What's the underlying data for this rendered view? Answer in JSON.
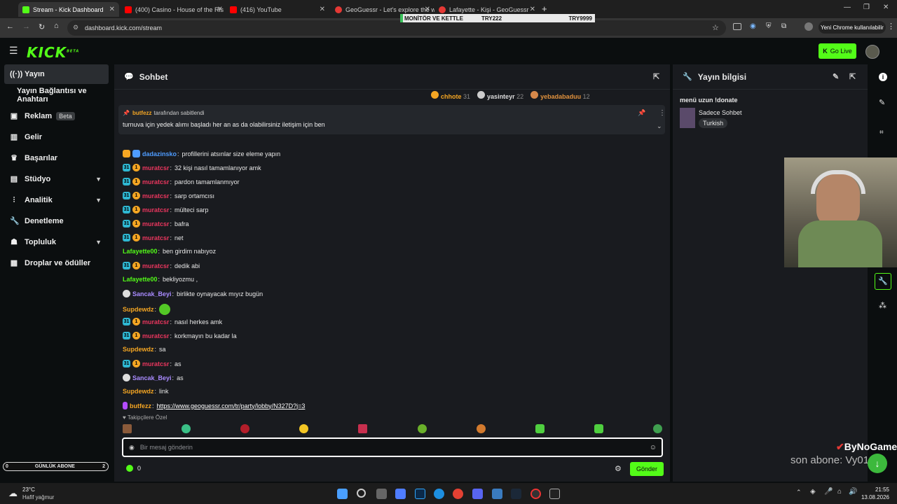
{
  "browser": {
    "tabs": [
      {
        "title": "Stream - Kick Dashboard",
        "color": "#53fc18"
      },
      {
        "title": "(400) Casino - House of the Ris",
        "color": "#ff0000"
      },
      {
        "title": "(416) YouTube",
        "color": "#ff0000"
      },
      {
        "title": "GeoGuessr - Let's explore the w",
        "color": "#e53935"
      },
      {
        "title": "Lafayette - Kişi - GeoGuessr",
        "color": "#e53935"
      }
    ],
    "url": "dashboard.kick.com/stream",
    "overlay": {
      "left": "MONİTÖR VE KETTLE",
      "mid": "TRY222",
      "right": "TRY9999"
    },
    "profile_label": "Yeni Chrome kullanılabilir"
  },
  "app": {
    "logo": "KICK",
    "logo_sup": "BETA",
    "go_live": "Go Live"
  },
  "sidebar": {
    "items": [
      {
        "label": "Yayın",
        "icon": "broadcast-icon"
      },
      {
        "label": "Yayın Bağlantısı ve Anahtarı",
        "icon": ""
      },
      {
        "label": "Reklam",
        "icon": "ad-icon",
        "badge": "Beta"
      },
      {
        "label": "Gelir",
        "icon": "revenue-icon"
      },
      {
        "label": "Başarılar",
        "icon": "trophy-icon"
      },
      {
        "label": "Stüdyo",
        "icon": "studio-icon"
      },
      {
        "label": "Analitik",
        "icon": "analytics-icon"
      },
      {
        "label": "Denetleme",
        "icon": "moderation-icon"
      },
      {
        "label": "Topluluk",
        "icon": "community-icon"
      },
      {
        "label": "Droplar ve ödüller",
        "icon": "drops-icon"
      }
    ]
  },
  "chat": {
    "title": "Sohbet",
    "top_gifters": [
      {
        "name": "chhote",
        "count": "31"
      },
      {
        "name": "yasinteyr",
        "count": "22"
      },
      {
        "name": "yebadabaduu",
        "count": "12"
      }
    ],
    "pinned": {
      "by_user": "butfezz",
      "by_suffix": "tarafından sabitlendi",
      "text": "turnuva için yedek alımı başladı her an as da olabilirsiniz iletişim için ben"
    },
    "messages": [
      {
        "user": "dadazinsko",
        "color": "#4e9cff",
        "badges": [
          "crown",
          "gift"
        ],
        "text": "profillerini atsınlar size eleme yapın"
      },
      {
        "user": "muratcsr",
        "color": "#e9365e",
        "badges": [
          "31",
          "1"
        ],
        "text": "32 kişi nasıl tamamlanıyor amk"
      },
      {
        "user": "muratcsr",
        "color": "#e9365e",
        "badges": [
          "31",
          "1"
        ],
        "text": "pardon tamamlanmıyor"
      },
      {
        "user": "muratcsr",
        "color": "#e9365e",
        "badges": [
          "31",
          "1"
        ],
        "text": "sarp ortamcısı"
      },
      {
        "user": "muratcsr",
        "color": "#e9365e",
        "badges": [
          "31",
          "1"
        ],
        "text": "mülteci sarp"
      },
      {
        "user": "muratcsr",
        "color": "#e9365e",
        "badges": [
          "31",
          "1"
        ],
        "text": "bafra"
      },
      {
        "user": "muratcsr",
        "color": "#e9365e",
        "badges": [
          "31",
          "1"
        ],
        "text": "net"
      },
      {
        "user": "Lafayette00",
        "color": "#53fc18",
        "badges": [],
        "text": "ben girdim nabıyoz"
      },
      {
        "user": "muratcsr",
        "color": "#e9365e",
        "badges": [
          "31",
          "1"
        ],
        "text": "dedik abi"
      },
      {
        "user": "Lafayette00",
        "color": "#53fc18",
        "badges": [],
        "text": "bekliyozmu ,"
      },
      {
        "user": "Sancak_Beyi",
        "color": "#a98bff",
        "badges": [
          "og"
        ],
        "text": "birlikte oynayacak mıyız bugün"
      },
      {
        "user": "Supdewdz",
        "color": "#f5a623",
        "badges": [],
        "text": ""
      },
      {
        "user": "muratcsr",
        "color": "#e9365e",
        "badges": [
          "31",
          "1"
        ],
        "text": "nasıl herkes amk"
      },
      {
        "user": "muratcsr",
        "color": "#e9365e",
        "badges": [
          "31",
          "1"
        ],
        "text": "korkmayın bu kadar la"
      },
      {
        "user": "Supdewdz",
        "color": "#f5a623",
        "badges": [],
        "text": "sa"
      },
      {
        "user": "muratcsr",
        "color": "#e9365e",
        "badges": [
          "31",
          "1"
        ],
        "text": "as"
      },
      {
        "user": "Sancak_Beyi",
        "color": "#a98bff",
        "badges": [
          "og"
        ],
        "text": "as"
      },
      {
        "user": "Supdewdz",
        "color": "#f5a623",
        "badges": [],
        "text": "link"
      },
      {
        "user": "butfezz",
        "color": "#f5a623",
        "badges": [
          "mic"
        ],
        "text": "https://www.geoguessr.com/tr/party/lobby/N327D?j=3",
        "link": true
      }
    ],
    "followers_only_label": "Takipçilere Özel",
    "input_placeholder": "Bir mesaj gönderin",
    "send_label": "Gönder",
    "points": "0"
  },
  "stream_info": {
    "title": "Yayın bilgisi",
    "stream_title": "menü uzun !donate",
    "category": "Sadece Sohbet",
    "tag": "Turkish"
  },
  "overlays": {
    "daily_sub_label": "GÜNLÜK ABONE",
    "daily_sub_left": "0",
    "daily_sub_right": "2",
    "brand": "ByNoGame",
    "last_sub": "son abone: Vy0123"
  },
  "taskbar": {
    "weather_temp": "23°C",
    "weather_desc": "Hafif yağmur",
    "time": "21:55",
    "date": "13.08.2026"
  },
  "colors": {
    "accent": "#53fc18",
    "panel": "#191b1f",
    "bg": "#0b0e0f"
  }
}
